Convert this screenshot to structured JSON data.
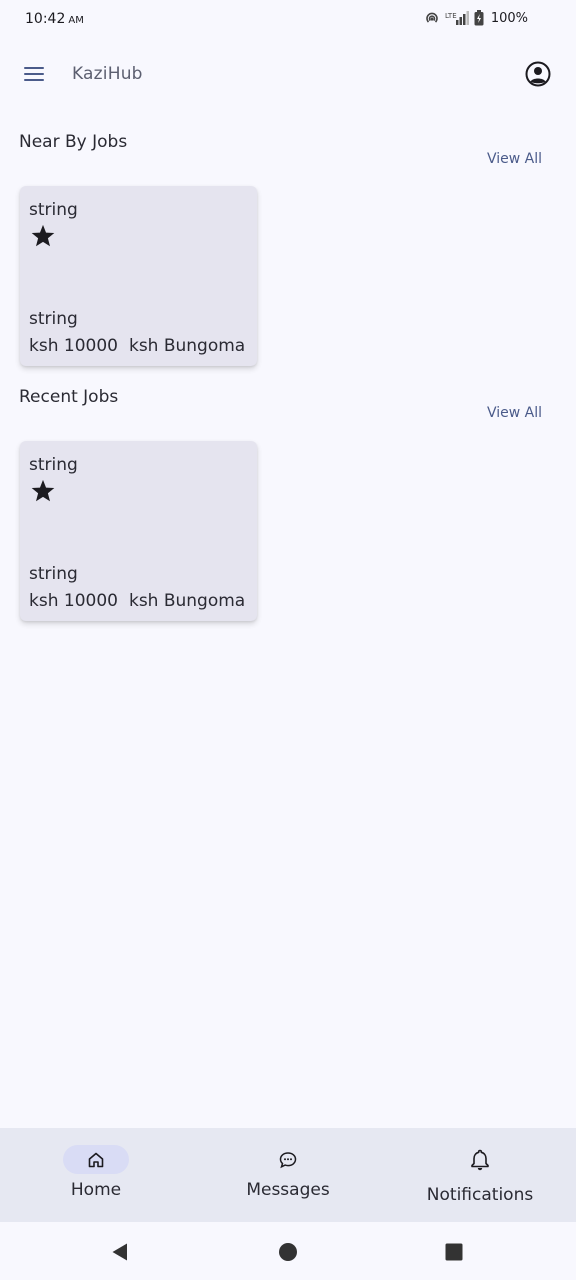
{
  "status_bar": {
    "time": "10:42",
    "ampm": "AM",
    "battery": "100%"
  },
  "app_bar": {
    "title": "KaziHub",
    "icons": [
      "menu-icon",
      "account-circle-icon"
    ]
  },
  "sections": [
    {
      "title": "Near By Jobs",
      "view_all": "View All",
      "card": {
        "title": "string",
        "subtitle": "string",
        "price": "ksh 10000",
        "location": "ksh Bungoma",
        "icon": "star-icon"
      }
    },
    {
      "title": "Recent Jobs",
      "view_all": "View All",
      "card": {
        "title": "string",
        "subtitle": "string",
        "price": "ksh 10000",
        "location": "ksh Bungoma",
        "icon": "star-icon"
      }
    }
  ],
  "bottom_nav": {
    "items": [
      {
        "label": "Home",
        "icon": "home-icon",
        "active": true
      },
      {
        "label": "Messages",
        "icon": "chat-bubble-icon",
        "active": false
      },
      {
        "label": "Notifications",
        "icon": "bell-icon",
        "active": false
      }
    ]
  },
  "system_nav": {
    "icons": [
      "back-icon",
      "home-circle-icon",
      "recents-icon"
    ]
  },
  "colors": {
    "background": "#f8f8fe",
    "card": "#e5e4ef",
    "nav_bar": "#e6e8f2",
    "active_pill": "#d9dcf5",
    "link": "#4b5b8a"
  }
}
